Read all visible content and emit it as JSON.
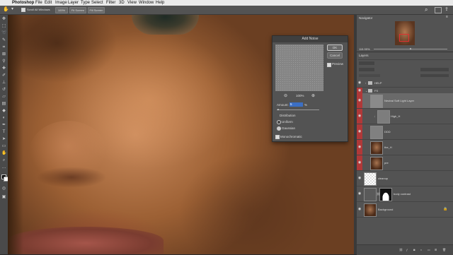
{
  "menubar": {
    "apple": "",
    "app": "Photoshop",
    "items": [
      "File",
      "Edit",
      "Image",
      "Layer",
      "Type",
      "Select",
      "Filter",
      "3D",
      "View",
      "Window",
      "Help"
    ]
  },
  "options": {
    "scroll_all": "Scroll All Windows",
    "zoom": "100%",
    "fit": "Fit Screen",
    "fill": "Fill Screen"
  },
  "dialog": {
    "title": "Add Noise",
    "ok": "OK",
    "cancel": "Cancel",
    "preview": "Preview",
    "zoom": "100%",
    "amount_label": "Amount:",
    "amount_value": "5",
    "amount_unit": "%",
    "distribution": "Distribution",
    "uniform": "Uniform",
    "gaussian": "Gaussian",
    "monochromatic": "Monochromatic"
  },
  "panels": {
    "navigator": "Navigator",
    "nav_zoom": "115.99%",
    "layers": "Layers"
  },
  "layers": [
    {
      "name": "HELP",
      "group": true
    },
    {
      "name": "FS",
      "group": true
    },
    {
      "name": "Neutral Soft Light Layer"
    },
    {
      "name": "High_H"
    },
    {
      "name": "DDD"
    },
    {
      "name": "the_H"
    },
    {
      "name": "pre"
    },
    {
      "name": "cleanup"
    },
    {
      "name": "body contrast"
    },
    {
      "name": "Background"
    }
  ]
}
